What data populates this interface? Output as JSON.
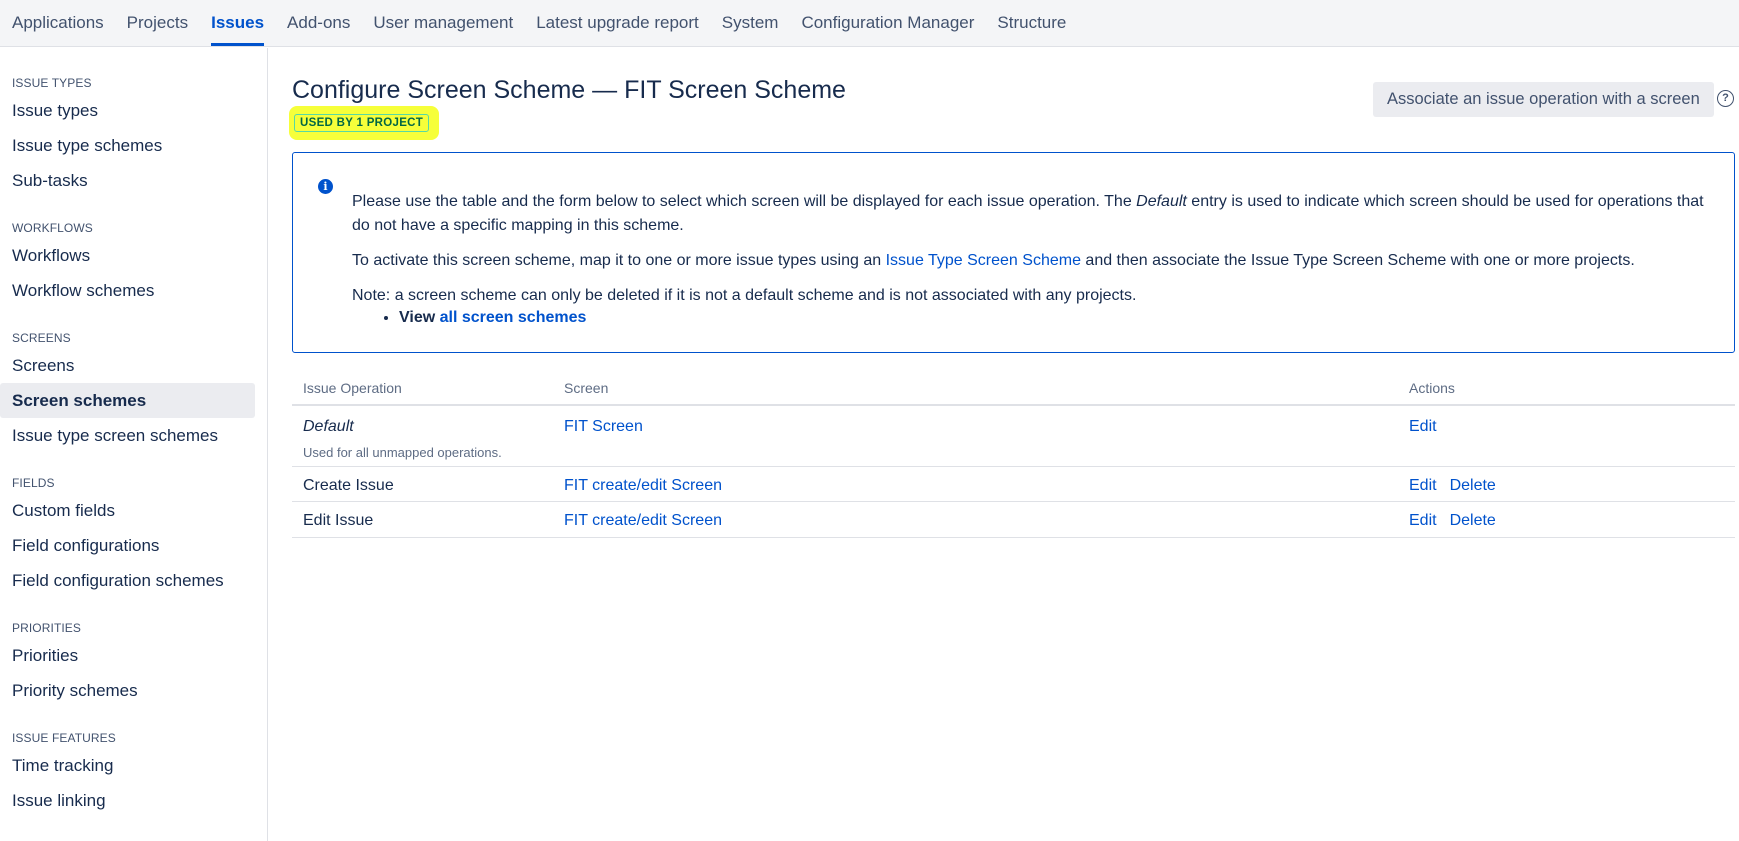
{
  "topnav": {
    "items": [
      {
        "label": "Applications",
        "active": false
      },
      {
        "label": "Projects",
        "active": false
      },
      {
        "label": "Issues",
        "active": true
      },
      {
        "label": "Add-ons",
        "active": false
      },
      {
        "label": "User management",
        "active": false
      },
      {
        "label": "Latest upgrade report",
        "active": false
      },
      {
        "label": "System",
        "active": false
      },
      {
        "label": "Configuration Manager",
        "active": false
      },
      {
        "label": "Structure",
        "active": false
      }
    ]
  },
  "sidebar": {
    "groups": [
      {
        "heading": "ISSUE TYPES",
        "items": [
          "Issue types",
          "Issue type schemes",
          "Sub-tasks"
        ]
      },
      {
        "heading": "WORKFLOWS",
        "items": [
          "Workflows",
          "Workflow schemes"
        ]
      },
      {
        "heading": "SCREENS",
        "items": [
          "Screens",
          "Screen schemes",
          "Issue type screen schemes"
        ]
      },
      {
        "heading": "FIELDS",
        "items": [
          "Custom fields",
          "Field configurations",
          "Field configuration schemes"
        ]
      },
      {
        "heading": "PRIORITIES",
        "items": [
          "Priorities",
          "Priority schemes"
        ]
      },
      {
        "heading": "ISSUE FEATURES",
        "items": [
          "Time tracking",
          "Issue linking"
        ]
      }
    ],
    "selected": "Screen schemes"
  },
  "page": {
    "title": "Configure Screen Scheme — FIT Screen Scheme",
    "lozenge": "USED BY 1 PROJECT",
    "associate_button": "Associate an issue operation with a screen",
    "help_icon": "?"
  },
  "info": {
    "icon": "i",
    "p1_a": "Please use the table and the form below to select which screen will be displayed for each issue operation. The ",
    "p1_em": "Default",
    "p1_b": " entry is used to indicate which screen should be used for operations that do not have a specific mapping in this scheme.",
    "p2_a": "To activate this screen scheme, map it to one or more issue types using an ",
    "p2_link": "Issue Type Screen Scheme",
    "p2_b": " and then associate the Issue Type Screen Scheme with one or more projects.",
    "p3": "Note: a screen scheme can only be deleted if it is not a default scheme and is not associated with any projects.",
    "view_label": "View ",
    "view_link": "all screen schemes"
  },
  "table": {
    "headers": {
      "operation": "Issue Operation",
      "screen": "Screen",
      "actions": "Actions"
    },
    "rows": [
      {
        "operation": "Default",
        "sub": "Used for all unmapped operations.",
        "screen": "FIT Screen",
        "edit": "Edit",
        "delete": ""
      },
      {
        "operation": "Create Issue",
        "sub": "",
        "screen": "FIT create/edit Screen",
        "edit": "Edit",
        "delete": "Delete"
      },
      {
        "operation": "Edit Issue",
        "sub": "",
        "screen": "FIT create/edit Screen",
        "edit": "Edit",
        "delete": "Delete"
      }
    ]
  }
}
